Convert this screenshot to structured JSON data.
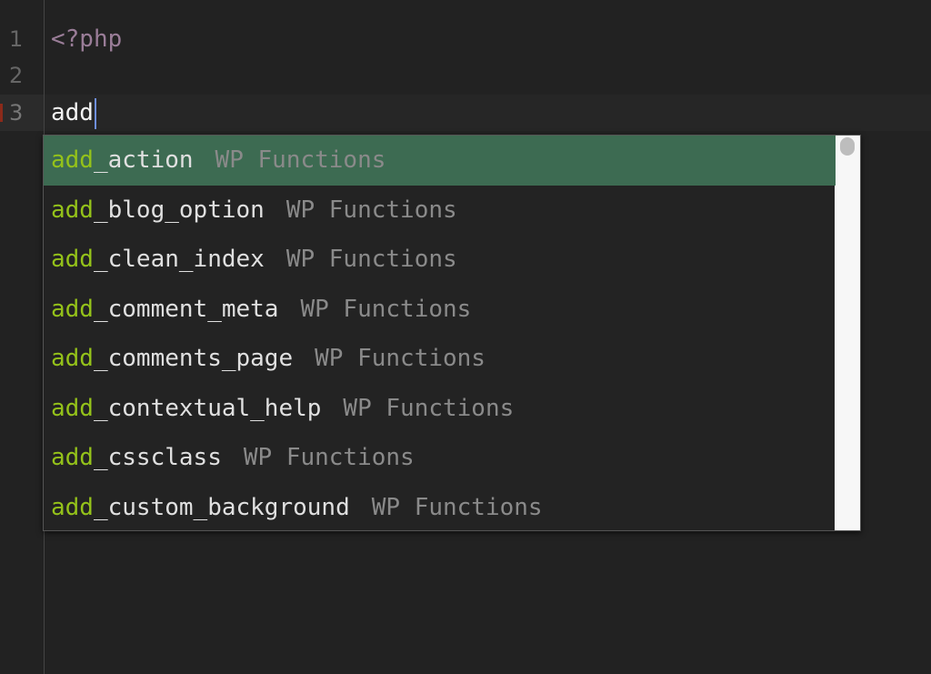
{
  "editor": {
    "lines": [
      {
        "number": "1",
        "text": "<?php"
      },
      {
        "number": "2",
        "text": ""
      },
      {
        "number": "3",
        "text": "add"
      }
    ]
  },
  "autocomplete": {
    "match": "add",
    "items": [
      {
        "rest": "_action",
        "type": "WP Functions",
        "selected": true
      },
      {
        "rest": "_blog_option",
        "type": "WP Functions"
      },
      {
        "rest": "_clean_index",
        "type": "WP Functions"
      },
      {
        "rest": "_comment_meta",
        "type": "WP Functions"
      },
      {
        "rest": "_comments_page",
        "type": "WP Functions"
      },
      {
        "rest": "_contextual_help",
        "type": "WP Functions"
      },
      {
        "rest": "_cssclass",
        "type": "WP Functions"
      },
      {
        "rest": "_custom_background",
        "type": "WP Functions"
      }
    ],
    "colors": {
      "selected_bg": "#3d6b52",
      "match": "#94c21a"
    }
  }
}
